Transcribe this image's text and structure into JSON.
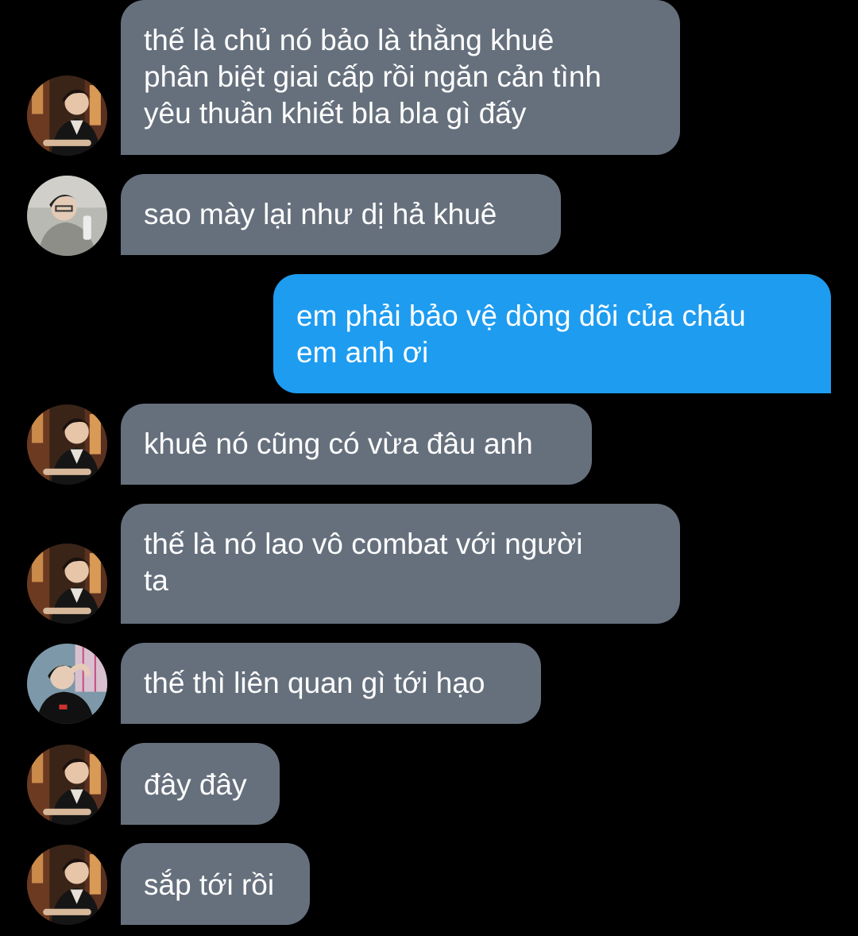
{
  "colors": {
    "background": "#000000",
    "incoming_bubble": "#66707d",
    "outgoing_bubble": "#1e9cf0",
    "text": "#ffffff"
  },
  "messages": [
    {
      "direction": "incoming",
      "avatar": "avatar-user-a-icon",
      "text": "thế là chủ nó bảo là thằng khuê\nphân biệt giai cấp rồi ngăn cản tình\nyêu thuần khiết bla bla gì đấy"
    },
    {
      "direction": "incoming",
      "avatar": "avatar-user-b-icon",
      "text": "sao mày lại như dị hả khuê"
    },
    {
      "direction": "outgoing",
      "text": "em phải bảo vệ dòng dõi của cháu\nem anh ơi"
    },
    {
      "direction": "incoming",
      "avatar": "avatar-user-a-icon",
      "text": "khuê nó cũng có vừa đâu anh"
    },
    {
      "direction": "incoming",
      "avatar": "avatar-user-a-icon",
      "text": "thế là nó lao vô combat với người\nta"
    },
    {
      "direction": "incoming",
      "avatar": "avatar-user-c-icon",
      "text": "thế thì liên quan gì tới hạo"
    },
    {
      "direction": "incoming",
      "avatar": "avatar-user-a-icon",
      "text": "đây đây"
    },
    {
      "direction": "incoming",
      "avatar": "avatar-user-a-icon",
      "text": "sắp tới rồi"
    }
  ]
}
